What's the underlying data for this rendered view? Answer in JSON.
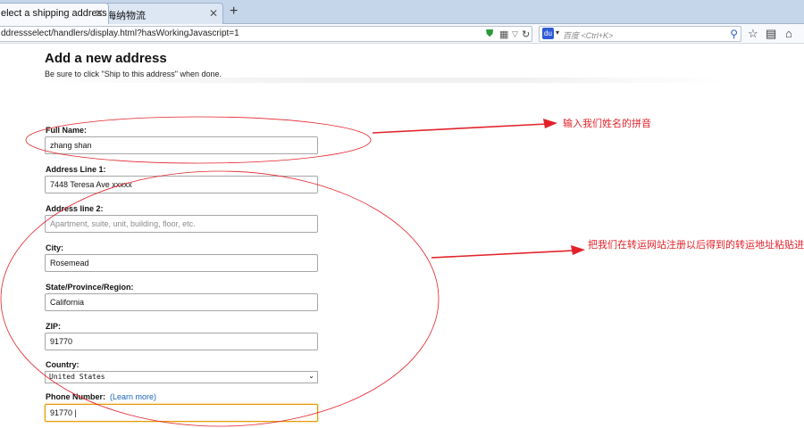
{
  "browser": {
    "tabs": [
      {
        "label": "elect a shipping address",
        "active": true
      },
      {
        "label": "海纳物流",
        "active": false
      }
    ],
    "new_tab_label": "+",
    "url": "ddressselect/handlers/display.html?hasWorkingJavascript=1",
    "search_placeholder": "百度 <Ctrl+K>",
    "search_engine_glyph": "du"
  },
  "form": {
    "title": "Add a new address",
    "hint": "Be sure to click \"Ship to this address\" when done.",
    "full_name": {
      "label": "Full Name:",
      "value": "zhang shan"
    },
    "address1": {
      "label": "Address Line 1:",
      "value": "7448 Teresa Ave xxxxx"
    },
    "address2": {
      "label": "Address line 2:",
      "placeholder": "Apartment, suite, unit, building, floor, etc.",
      "value": ""
    },
    "city": {
      "label": "City:",
      "value": "Rosemead"
    },
    "state": {
      "label": "State/Province/Region:",
      "value": "California"
    },
    "zip": {
      "label": "ZIP:",
      "value": "91770"
    },
    "country": {
      "label": "Country:",
      "value": "United States"
    },
    "phone": {
      "label": "Phone Number:",
      "learn_more": "(Learn more)",
      "value": "91770 |"
    }
  },
  "annotations": {
    "name_note": "输入我们姓名的拼音",
    "address_note": "把我们在转运网站注册以后得到的转运地址粘贴进去"
  },
  "colors": {
    "annotation": "#e2222a",
    "link": "#1b63b8",
    "focus": "#e59700",
    "tab_bar": "#c5d6ea"
  }
}
